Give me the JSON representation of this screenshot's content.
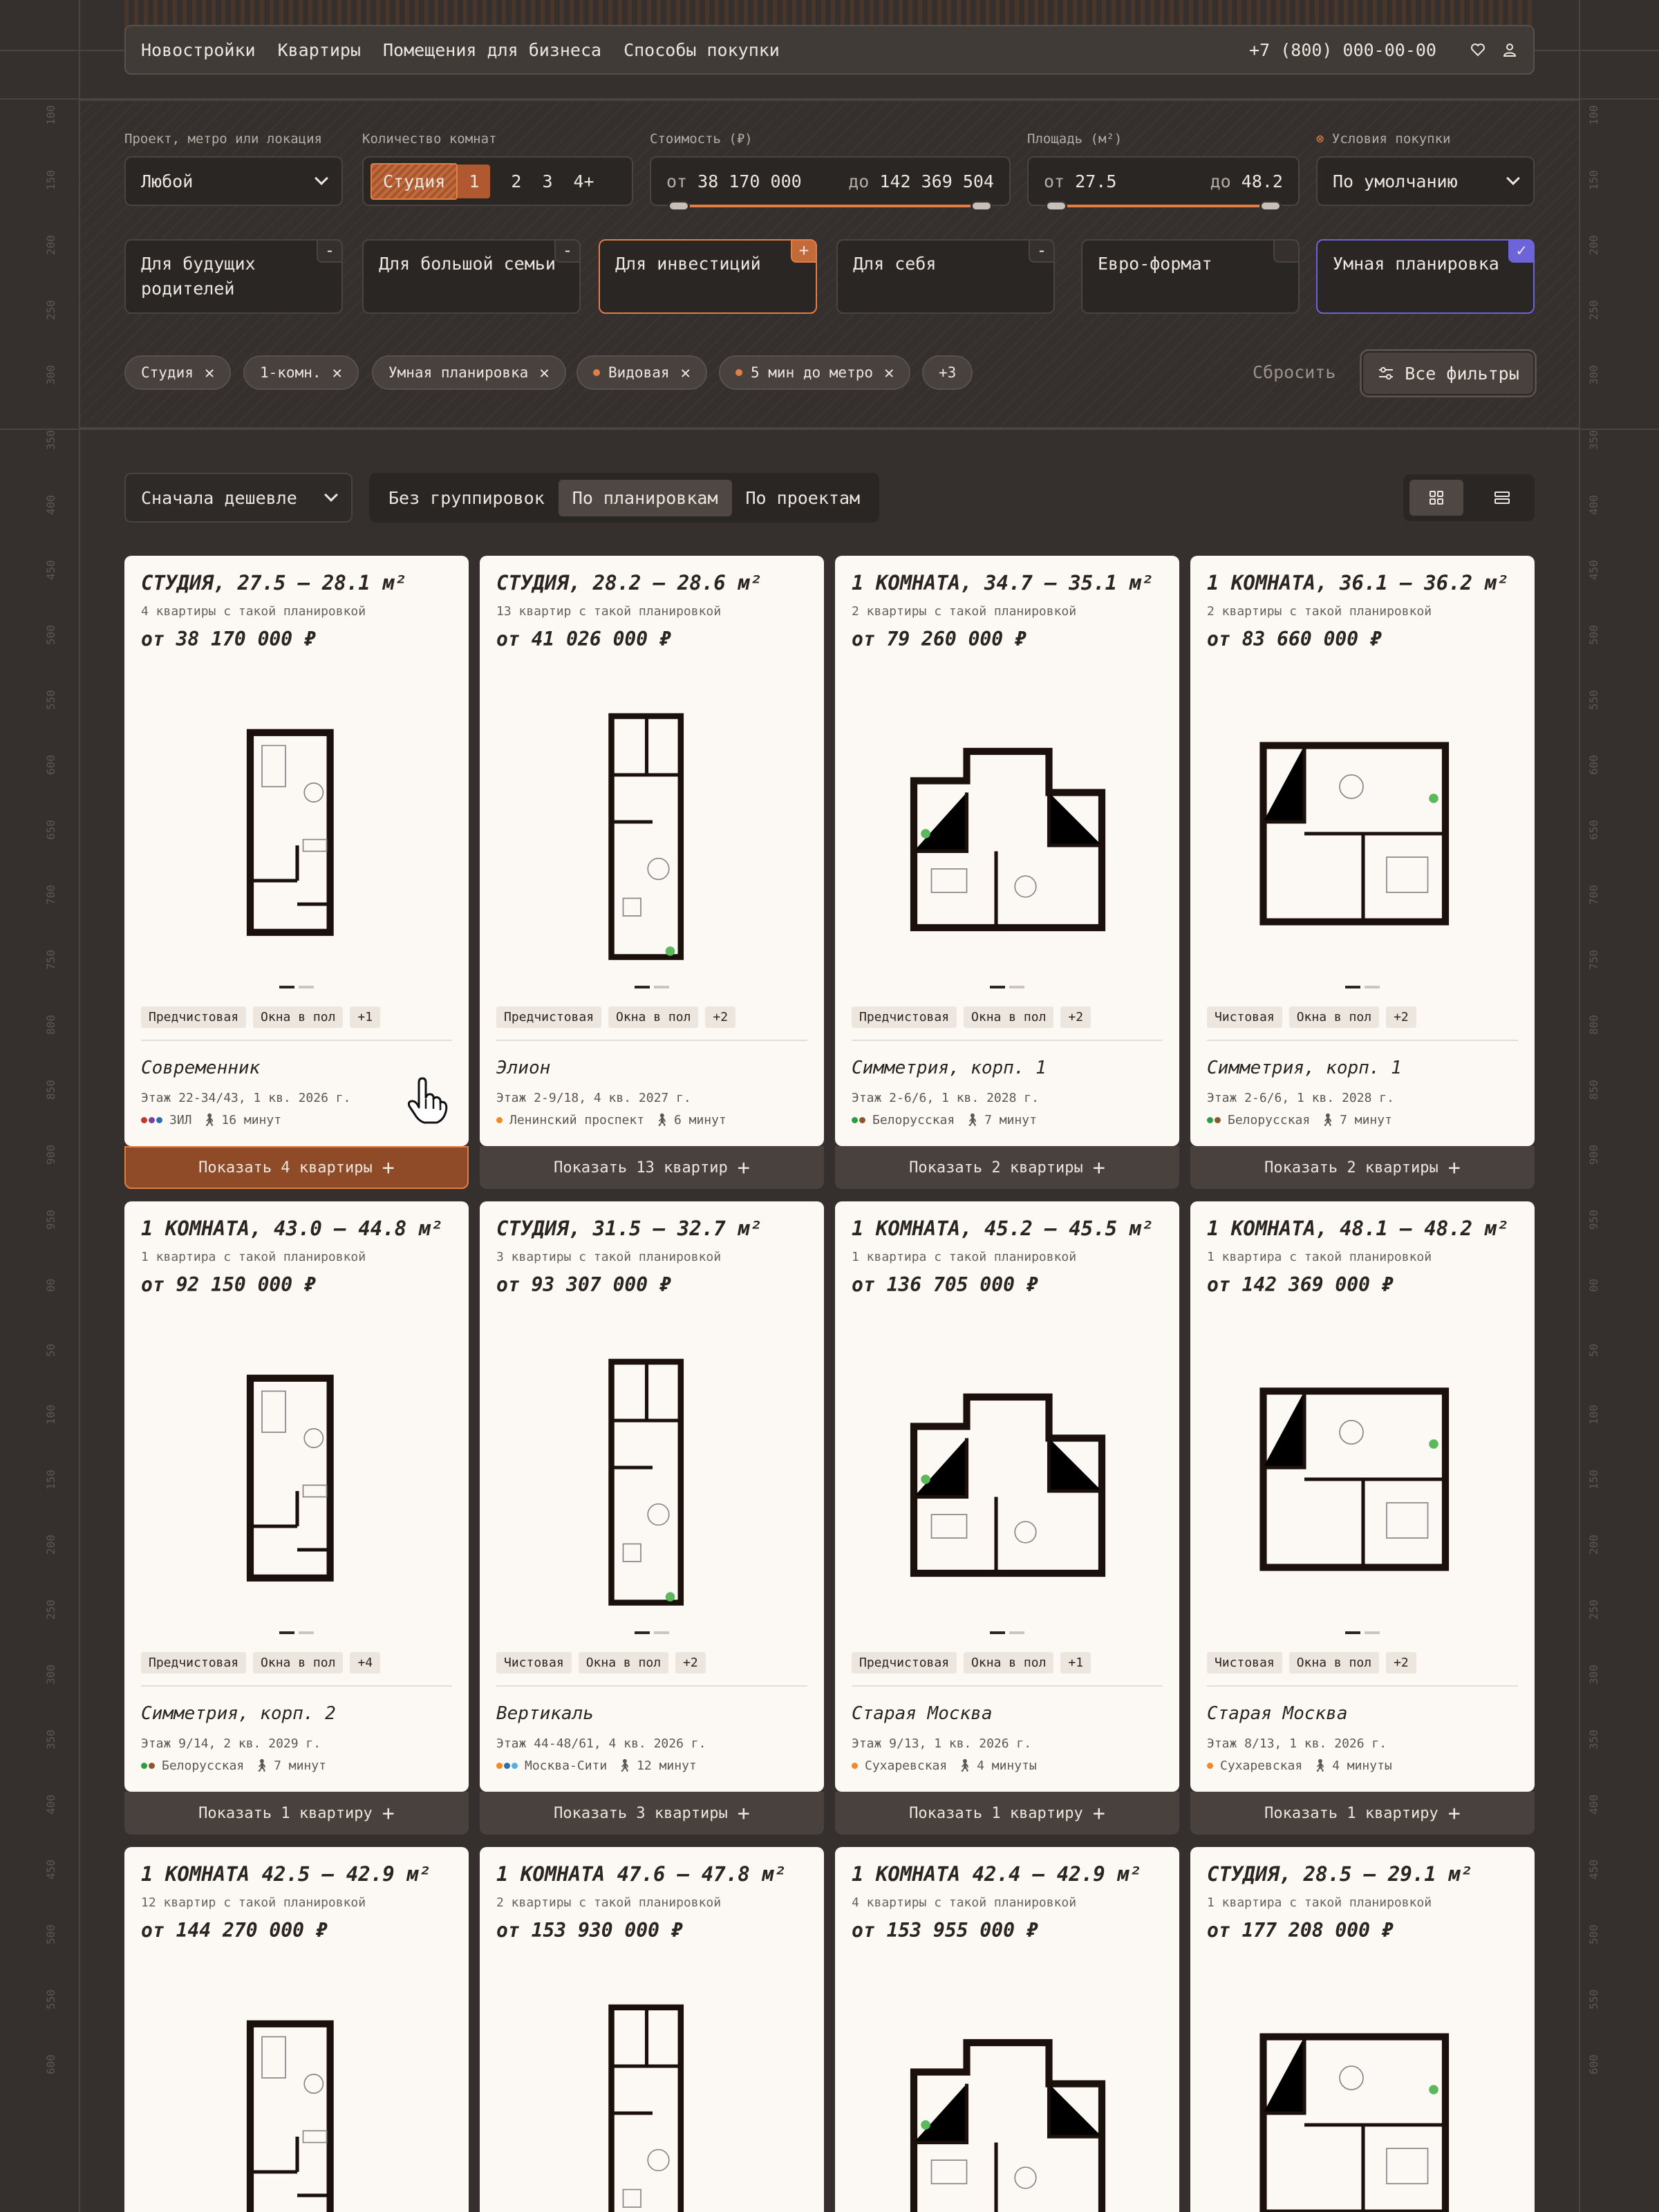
{
  "nav": {
    "items": [
      "Новостройки",
      "Квартиры",
      "Помещения для бизнеса",
      "Способы покупки"
    ],
    "phone": "+7 (800) 000-00-00"
  },
  "filters": {
    "project": {
      "label": "Проект, метро или локация",
      "value": "Любой"
    },
    "rooms": {
      "label": "Количество комнат",
      "options": [
        "Студия",
        "1",
        "2",
        "3",
        "4+"
      ],
      "selected": [
        "Студия",
        "1"
      ]
    },
    "price": {
      "label": "Стоимость (₽)",
      "from_label": "от",
      "from": "38 170 000",
      "to_label": "до",
      "to": "142 369 504"
    },
    "area": {
      "label": "Площадь (м²)",
      "from_label": "от",
      "from": "27.5",
      "to_label": "до",
      "to": "48.2"
    },
    "terms": {
      "label": "Условия покупки",
      "value": "По умолчанию"
    },
    "categories": [
      {
        "label": "Для будущих родителей",
        "mark": "-"
      },
      {
        "label": "Для большой семьи",
        "mark": "-"
      },
      {
        "label": "Для инвестиций",
        "mark": "+"
      },
      {
        "label": "Для себя",
        "mark": "-"
      },
      {
        "label": "Евро-формат",
        "mark": ""
      },
      {
        "label": "Умная планировка",
        "mark": "✓"
      }
    ],
    "chips": [
      "Студия",
      "1-комн.",
      "Умная планировка",
      "Видовая",
      "5 мин до метро",
      "+3"
    ],
    "reset": "Сбросить",
    "all_filters": "Все фильтры"
  },
  "sort": {
    "value": "Сначала дешевле"
  },
  "grouping": {
    "options": [
      "Без группировок",
      "По планировкам",
      "По проектам"
    ],
    "selected": "По планировкам"
  },
  "cards": [
    {
      "title": "СТУДИЯ, 27.5 — 28.1 м²",
      "subtitle": "4 квартиры с такой планировкой",
      "price": "от 38 170 000 ₽",
      "tags": [
        "Предчистовая",
        "Окна в пол",
        "+1"
      ],
      "project": "Современник",
      "meta": "Этаж 22-34/43, 1 кв. 2026 г.",
      "metro": "ЗИЛ",
      "walk": "16 минут",
      "show": "Показать 4 квартиры",
      "metro_colors": [
        "#c0392b",
        "#7a3fa0",
        "#2c6db5"
      ]
    },
    {
      "title": "СТУДИЯ, 28.2 — 28.6 м²",
      "subtitle": "13 квартир с такой планировкой",
      "price": "от 41 026 000 ₽",
      "tags": [
        "Предчистовая",
        "Окна в пол",
        "+2"
      ],
      "project": "Элион",
      "meta": "Этаж 2-9/18, 4 кв. 2027 г.",
      "metro": "Ленинский проспект",
      "walk": "6 минут",
      "show": "Показать 13 квартир",
      "metro_colors": [
        "#f08a24"
      ]
    },
    {
      "title": "1 КОМНАТА, 34.7 — 35.1 м²",
      "subtitle": "2 квартиры с такой планировкой",
      "price": "от 79 260 000 ₽",
      "tags": [
        "Предчистовая",
        "Окна в пол",
        "+2"
      ],
      "project": "Симметрия, корп. 1",
      "meta": "Этаж 2-6/6, 1 кв. 2028 г.",
      "metro": "Белорусская",
      "walk": "7 минут",
      "show": "Показать 2 квартиры",
      "metro_colors": [
        "#2e9b3f",
        "#8a5a2b"
      ]
    },
    {
      "title": "1 КОМНАТА, 36.1 — 36.2 м²",
      "subtitle": "2 квартиры с такой планировкой",
      "price": "от 83 660 000 ₽",
      "tags": [
        "Чистовая",
        "Окна в пол",
        "+2"
      ],
      "project": "Симметрия, корп. 1",
      "meta": "Этаж 2-6/6, 1 кв. 2028 г.",
      "metro": "Белорусская",
      "walk": "7 минут",
      "show": "Показать 2 квартиры",
      "metro_colors": [
        "#2e9b3f",
        "#8a5a2b"
      ]
    },
    {
      "title": "1 КОМНАТА, 43.0 — 44.8 м²",
      "subtitle": "1 квартира с такой планировкой",
      "price": "от 92 150 000 ₽",
      "tags": [
        "Предчистовая",
        "Окна в пол",
        "+4"
      ],
      "project": "Симметрия, корп. 2",
      "meta": "Этаж 9/14, 2 кв. 2029 г.",
      "metro": "Белорусская",
      "walk": "7 минут",
      "show": "Показать 1 квартиру",
      "metro_colors": [
        "#2e9b3f",
        "#8a5a2b"
      ]
    },
    {
      "title": "СТУДИЯ, 31.5 — 32.7 м²",
      "subtitle": "3 квартиры с такой планировкой",
      "price": "от 93 307 000 ₽",
      "tags": [
        "Чистовая",
        "Окна в пол",
        "+2"
      ],
      "project": "Вертикаль",
      "meta": "Этаж 44-48/61, 4 кв. 2026 г.",
      "metro": "Москва-Сити",
      "walk": "12 минут",
      "show": "Показать 3 квартиры",
      "metro_colors": [
        "#f08a24",
        "#2c6db5",
        "#55b0e0"
      ]
    },
    {
      "title": "1 КОМНАТА, 45.2 — 45.5 м²",
      "subtitle": "1 квартира с такой планировкой",
      "price": "от 136 705 000 ₽",
      "tags": [
        "Предчистовая",
        "Окна в пол",
        "+1"
      ],
      "project": "Старая Москва",
      "meta": "Этаж 9/13, 1 кв. 2026 г.",
      "metro": "Сухаревская",
      "walk": "4 минуты",
      "show": "Показать 1 квартиру",
      "metro_colors": [
        "#f08a24"
      ]
    },
    {
      "title": "1 КОМНАТА, 48.1 — 48.2 м²",
      "subtitle": "1 квартира с такой планировкой",
      "price": "от 142 369 000 ₽",
      "tags": [
        "Чистовая",
        "Окна в пол",
        "+2"
      ],
      "project": "Старая Москва",
      "meta": "Этаж 8/13, 1 кв. 2026 г.",
      "metro": "Сухаревская",
      "walk": "4 минуты",
      "show": "Показать 1 квартиру",
      "metro_colors": [
        "#f08a24"
      ]
    },
    {
      "title": "1 КОМНАТА 42.5 — 42.9 м²",
      "subtitle": "12 квартир с такой планировкой",
      "price": "от 144 270 000 ₽"
    },
    {
      "title": "1 КОМНАТА 47.6 — 47.8 м²",
      "subtitle": "2 квартиры с такой планировкой",
      "price": "от 153 930 000 ₽"
    },
    {
      "title": "1 КОМНАТА 42.4 — 42.9 м²",
      "subtitle": "4 квартиры с такой планировкой",
      "price": "от 153 955 000 ₽"
    },
    {
      "title": "СТУДИЯ, 28.5 — 29.1 м²",
      "subtitle": "1 квартира с такой планировкой",
      "price": "от 177 208 000 ₽"
    }
  ],
  "colors": {
    "accent": "#e27d45",
    "smart": "#6c64d8",
    "bg": "#35302d",
    "card": "#fcf8f3"
  },
  "icons": [
    "heart-icon",
    "user-icon",
    "chevron-down-icon",
    "close-icon",
    "filters-icon",
    "grid-view-icon",
    "list-view-icon",
    "plus-icon",
    "walk-icon",
    "hand-cursor-icon"
  ]
}
